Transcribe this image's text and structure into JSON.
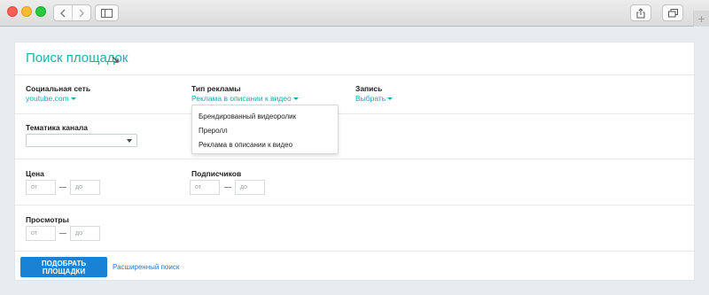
{
  "browser": {
    "back_icon": "chevron-left-icon",
    "forward_icon": "chevron-right-icon",
    "sidebar_icon": "sidebar-icon",
    "share_icon": "share-icon",
    "tabs_icon": "tabs-icon",
    "new_tab": "+"
  },
  "page": {
    "title": "Поиск площадок",
    "title_icon": "collapse-arrow-icon"
  },
  "filters": {
    "social": {
      "label": "Социальная сеть",
      "value": "youtube.com"
    },
    "ad_type": {
      "label": "Тип рекламы",
      "value": "Реклама в описании к видео",
      "options": [
        "Брендированный видеоролик",
        "Преролл",
        "Реклама в описании к видео"
      ]
    },
    "record": {
      "label": "Запись",
      "value": "Выбрать"
    },
    "topic": {
      "label": "Тематика канала",
      "value": ""
    },
    "price": {
      "label": "Цена",
      "from_placeholder": "от",
      "to_placeholder": "до"
    },
    "subscribers": {
      "label": "Подписчиков",
      "from_placeholder": "от",
      "to_placeholder": "до"
    },
    "views": {
      "label": "Просмотры",
      "from_placeholder": "от",
      "to_placeholder": "до"
    }
  },
  "actions": {
    "submit_label": "ПОДОБРАТЬ ПЛОЩАДКИ",
    "advanced_label": "Расширенный поиск"
  },
  "colors": {
    "accent": "#20b0b0",
    "link": "#1aa7b5",
    "primary_button": "#1a82d4"
  }
}
